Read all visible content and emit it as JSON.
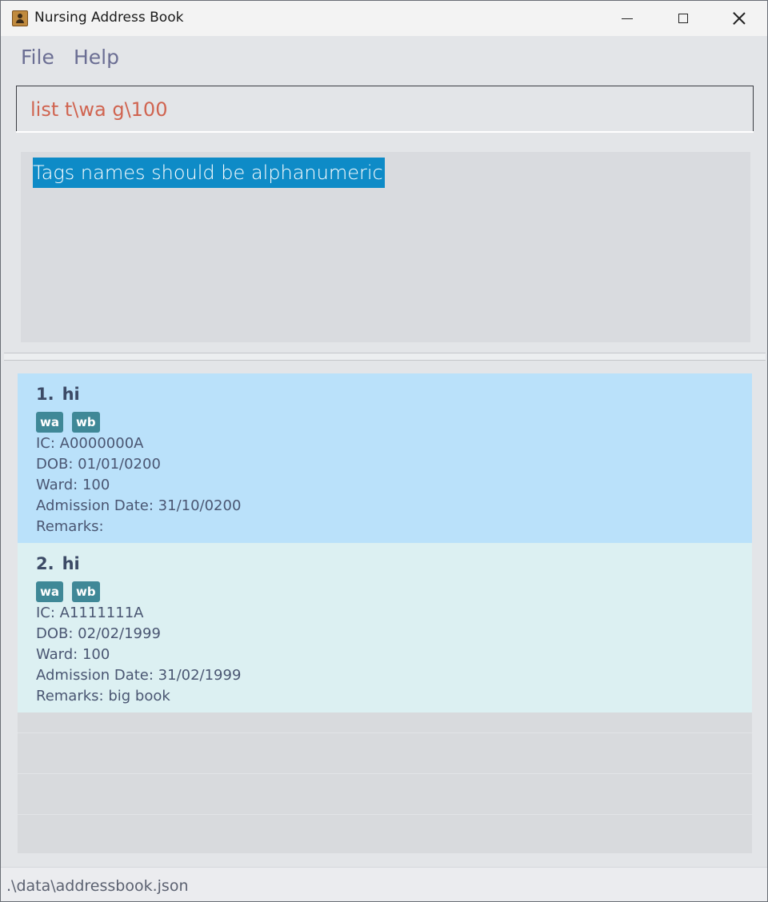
{
  "window": {
    "title": "Nursing Address Book"
  },
  "menu": {
    "file": "File",
    "help": "Help"
  },
  "command": {
    "value": "list t\\wa g\\100"
  },
  "result": {
    "message": "Tags names should be alphanumeric"
  },
  "persons": [
    {
      "index": "1.",
      "name": "hi",
      "tags": [
        "wa",
        "wb"
      ],
      "ic": "IC: A0000000A",
      "dob": "DOB: 01/01/0200",
      "ward": "Ward: 100",
      "admission": "Admission Date: 31/10/0200",
      "remarks": "Remarks:"
    },
    {
      "index": "2.",
      "name": "hi",
      "tags": [
        "wa",
        "wb"
      ],
      "ic": "IC: A1111111A",
      "dob": "DOB: 02/02/1999",
      "ward": "Ward: 100",
      "admission": "Admission Date: 31/02/1999",
      "remarks": "Remarks: big book"
    }
  ],
  "status": {
    "path": ".\\data\\addressbook.json"
  },
  "colors": {
    "selected_card": "#bae1fa",
    "card": "#dcf0f2",
    "tag": "#3f8897",
    "result_highlight": "#0e8bc7",
    "command_text": "#d06450"
  }
}
